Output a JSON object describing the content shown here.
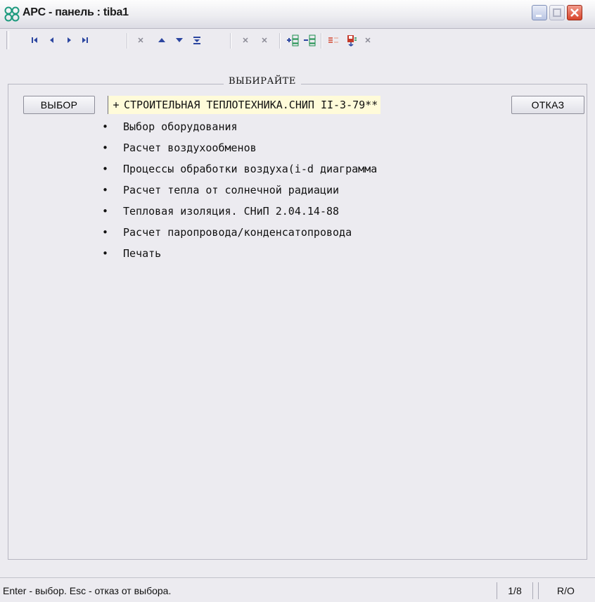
{
  "window": {
    "title": "APC - панель : tiba1"
  },
  "toolbar": {
    "buttons": [
      {
        "name": "first-record-icon"
      },
      {
        "name": "previous-record-icon"
      },
      {
        "name": "next-record-icon"
      },
      {
        "name": "last-record-icon"
      },
      {
        "name": "delete-icon"
      },
      {
        "name": "move-up-icon"
      },
      {
        "name": "move-down-icon"
      },
      {
        "name": "sort-icon"
      },
      {
        "name": "cut-icon"
      },
      {
        "name": "clear-icon"
      },
      {
        "name": "insert-row-icon"
      },
      {
        "name": "delete-row-icon"
      },
      {
        "name": "link-icon"
      },
      {
        "name": "save-icon"
      },
      {
        "name": "close-icon"
      }
    ]
  },
  "panel": {
    "legend": "ВЫБИРАЙТЕ",
    "select_button": "ВЫБОР",
    "cancel_button": "ОТКАЗ",
    "items": [
      {
        "bullet": "+",
        "label": "СТРОИТЕЛЬНАЯ ТЕПЛОТЕХНИКА.СНИП II-3-79**",
        "active": true
      },
      {
        "bullet": "•",
        "label": "Выбор оборудования"
      },
      {
        "bullet": "•",
        "label": "Расчет воздухообменов"
      },
      {
        "bullet": "•",
        "label": "Процессы обработки воздуха(i-d диаграмма"
      },
      {
        "bullet": "•",
        "label": "Расчет тепла от солнечной радиации"
      },
      {
        "bullet": "•",
        "label": "Тепловая изоляция. СНиП 2.04.14-88"
      },
      {
        "bullet": "•",
        "label": "Расчет паропровода/конденсатопровода"
      },
      {
        "bullet": "•",
        "label": "Печать"
      }
    ]
  },
  "status": {
    "message": "Enter - выбор. Esc - отказ от выбора.",
    "position": "1/8",
    "mode": "R/O"
  },
  "colors": {
    "highlight": "#fffbd9",
    "toolbar_icon": "#2c46a0",
    "window_bg": "#ecebf0"
  }
}
